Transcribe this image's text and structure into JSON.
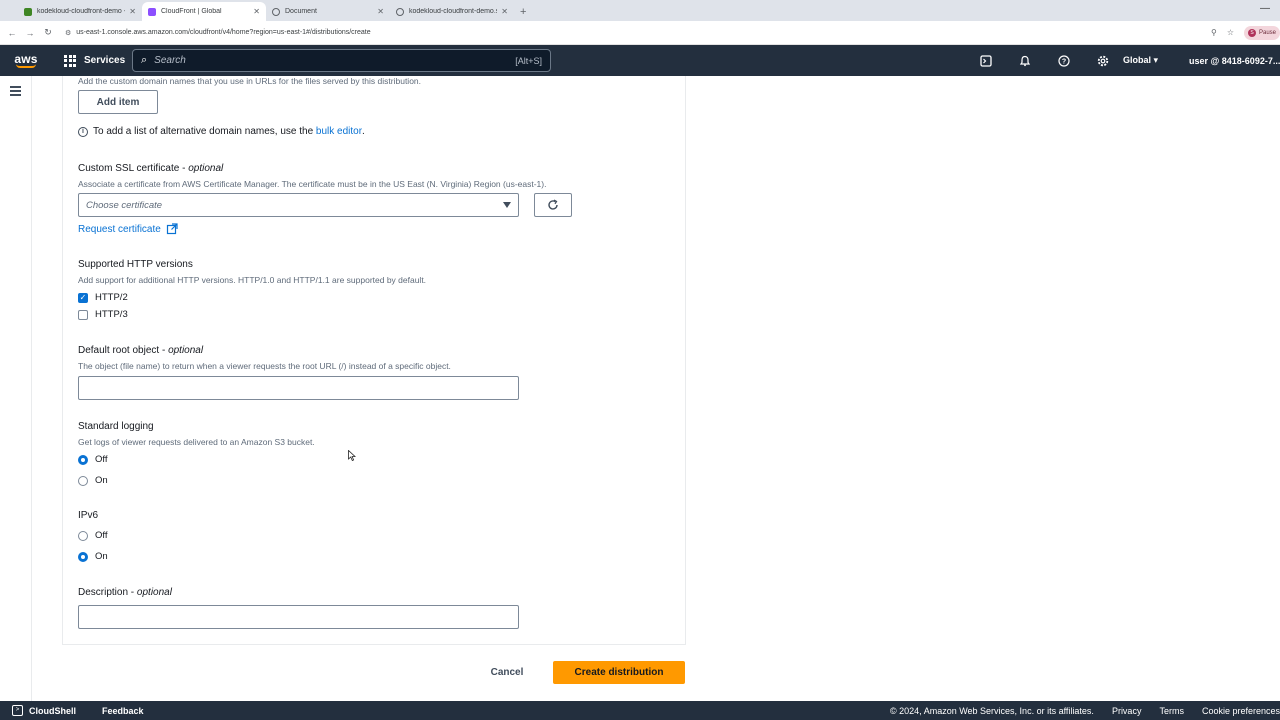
{
  "browser": {
    "tabs": [
      {
        "label": "kodekloud-cloudfront-demo - S3 bucket",
        "favicon_color": "#3f8624",
        "active": false
      },
      {
        "label": "CloudFront | Global",
        "favicon_color": "#8c4fff",
        "active": true
      },
      {
        "label": "Document",
        "favicon_color": "#5f6368",
        "active": false
      },
      {
        "label": "kodekloud-cloudfront-demo.s3",
        "favicon_color": "#5f6368",
        "active": false
      }
    ],
    "url": "us-east-1.console.aws.amazon.com/cloudfront/v4/home?region=us-east-1#/distributions/create",
    "profile_label": "Pause"
  },
  "aws_nav": {
    "logo": "aws",
    "services_label": "Services",
    "search_placeholder": "Search",
    "search_shortcut": "[Alt+S]",
    "region": "Global ▾",
    "user": "user @ 8418-6092-7..."
  },
  "form": {
    "alt_domain_desc": "Add the custom domain names that you use in URLs for the files served by this distribution.",
    "add_item_label": "Add item",
    "bulk_note_prefix": "To add a list of alternative domain names, use the ",
    "bulk_note_link": "bulk editor",
    "bulk_note_suffix": ".",
    "ssl": {
      "label": "Custom SSL certificate",
      "optional": "optional",
      "desc": "Associate a certificate from AWS Certificate Manager. The certificate must be in the US East (N. Virginia) Region (us-east-1).",
      "placeholder": "Choose certificate",
      "request_link": "Request certificate"
    },
    "http": {
      "label": "Supported HTTP versions",
      "desc": "Add support for additional HTTP versions. HTTP/1.0 and HTTP/1.1 are supported by default.",
      "options": [
        {
          "label": "HTTP/2",
          "checked": true
        },
        {
          "label": "HTTP/3",
          "checked": false
        }
      ]
    },
    "root_object": {
      "label": "Default root object",
      "optional": "optional",
      "desc": "The object (file name) to return when a viewer requests the root URL (/) instead of a specific object.",
      "value": ""
    },
    "logging": {
      "label": "Standard logging",
      "desc": "Get logs of viewer requests delivered to an Amazon S3 bucket.",
      "options": [
        {
          "label": "Off",
          "selected": true
        },
        {
          "label": "On",
          "selected": false
        }
      ]
    },
    "ipv6": {
      "label": "IPv6",
      "options": [
        {
          "label": "Off",
          "selected": false
        },
        {
          "label": "On",
          "selected": true
        }
      ]
    },
    "description": {
      "label": "Description",
      "optional": "optional",
      "value": ""
    }
  },
  "actions": {
    "cancel_label": "Cancel",
    "create_label": "Create distribution"
  },
  "footer": {
    "cloudshell": "CloudShell",
    "feedback": "Feedback",
    "copyright": "© 2024, Amazon Web Services, Inc. or its affiliates.",
    "privacy": "Privacy",
    "terms": "Terms",
    "cookie": "Cookie preferences"
  }
}
